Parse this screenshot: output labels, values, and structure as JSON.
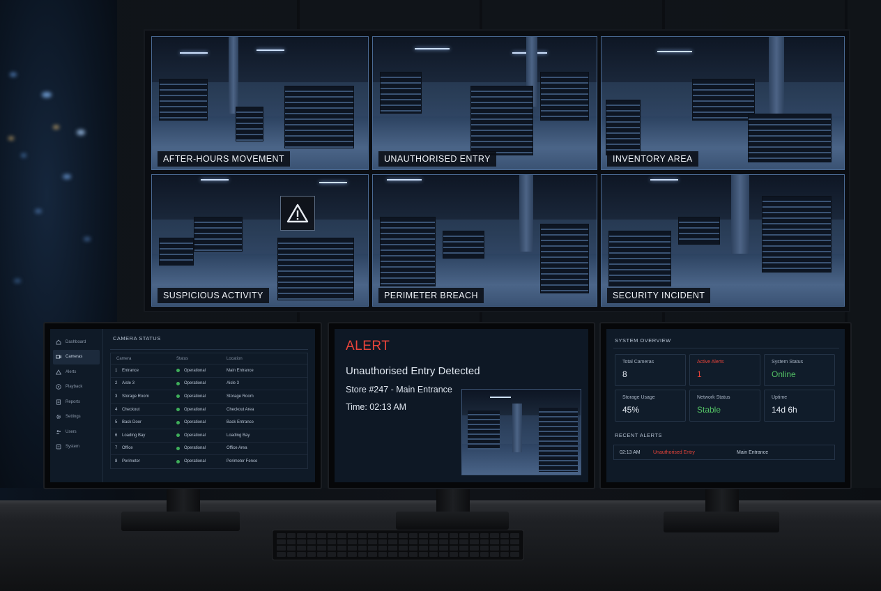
{
  "video_wall": {
    "tiles": [
      {
        "label": "AFTER-HOURS MOVEMENT"
      },
      {
        "label": "UNAUTHORISED ENTRY"
      },
      {
        "label": "INVENTORY AREA"
      },
      {
        "label": "SUSPICIOUS ACTIVITY"
      },
      {
        "label": "PERIMETER BREACH"
      },
      {
        "label": "SECURITY INCIDENT"
      }
    ]
  },
  "left_monitor": {
    "nav": [
      {
        "label": "Dashboard",
        "icon": "home-icon"
      },
      {
        "label": "Cameras",
        "icon": "camera-icon"
      },
      {
        "label": "Alerts",
        "icon": "warning-icon"
      },
      {
        "label": "Playback",
        "icon": "play-icon"
      },
      {
        "label": "Reports",
        "icon": "document-icon"
      },
      {
        "label": "Settings",
        "icon": "gear-icon"
      },
      {
        "label": "Users",
        "icon": "users-icon"
      },
      {
        "label": "System",
        "icon": "system-icon"
      }
    ],
    "panel_title": "CAMERA STATUS",
    "columns": {
      "camera": "Camera",
      "status": "Status",
      "location": "Location"
    },
    "rows": [
      {
        "num": "1",
        "camera": "Entrance",
        "status": "Operational",
        "location": "Main Entrance"
      },
      {
        "num": "2",
        "camera": "Aisle 3",
        "status": "Operational",
        "location": "Aisle 3"
      },
      {
        "num": "3",
        "camera": "Storage Room",
        "status": "Operational",
        "location": "Storage Room"
      },
      {
        "num": "4",
        "camera": "Checkout",
        "status": "Operational",
        "location": "Checkout Area"
      },
      {
        "num": "5",
        "camera": "Back Door",
        "status": "Operational",
        "location": "Back Entrance"
      },
      {
        "num": "6",
        "camera": "Loading Bay",
        "status": "Operational",
        "location": "Loading Bay"
      },
      {
        "num": "7",
        "camera": "Office",
        "status": "Operational",
        "location": "Office Area"
      },
      {
        "num": "8",
        "camera": "Perimeter",
        "status": "Operational",
        "location": "Perimeter Fence"
      }
    ]
  },
  "center_monitor": {
    "alert_title": "ALERT",
    "headline": "Unauthorised Entry Detected",
    "store": "Store #247 - Main Entrance",
    "time": "Time: 02:13 AM"
  },
  "right_monitor": {
    "title": "SYSTEM OVERVIEW",
    "stats": [
      {
        "label": "Total Cameras",
        "value": "8"
      },
      {
        "label": "Active Alerts",
        "value": "1"
      },
      {
        "label": "System Status",
        "value": "Online"
      },
      {
        "label": "Storage Usage",
        "value": "45%"
      },
      {
        "label": "Network Status",
        "value": "Stable"
      },
      {
        "label": "Uptime",
        "value": "14d 6h"
      }
    ],
    "recent_title": "RECENT ALERTS",
    "recent": [
      {
        "time": "02:13 AM",
        "event": "Unauthorised Entry",
        "location": "Main Entrance"
      }
    ]
  },
  "colors": {
    "alert": "#e8443a",
    "ok": "#52c064",
    "screen_bg": "#0f1a27"
  }
}
